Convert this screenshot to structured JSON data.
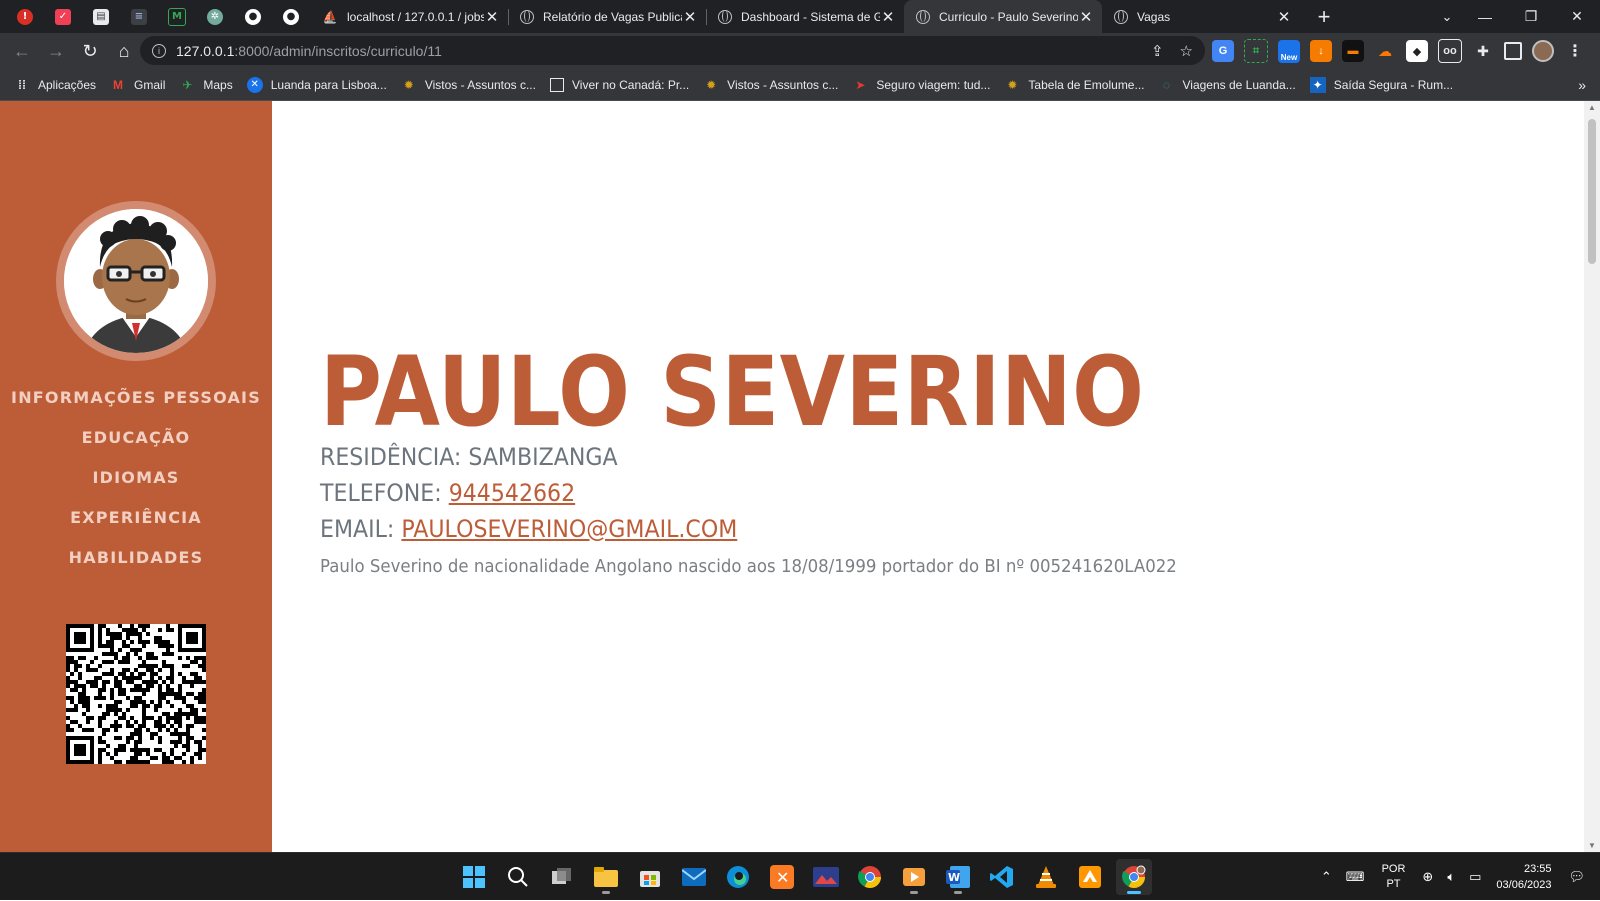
{
  "browser": {
    "tabs": [
      {
        "title": "localhost / 127.0.0.1 / jobs",
        "icon": "phpmyadmin-icon",
        "active": false
      },
      {
        "title": "Relatório de Vagas Publicadas",
        "icon": "globe-icon",
        "active": false
      },
      {
        "title": "Dashboard - Sistema de Gestão",
        "icon": "globe-icon",
        "active": false
      },
      {
        "title": "Curriculo - Paulo Severino",
        "icon": "globe-icon",
        "active": true
      },
      {
        "title": "Vagas",
        "icon": "globe-icon",
        "active": false
      }
    ],
    "url_host": "127.0.0.1",
    "url_rest": ":8000/admin/inscritos/curriculo/11",
    "new_badge": "New",
    "bookmarks": [
      {
        "label": "Aplicações",
        "icon": "apps-grid-icon"
      },
      {
        "label": "Gmail",
        "icon": "gmail-icon"
      },
      {
        "label": "Maps",
        "icon": "maps-icon"
      },
      {
        "label": "Luanda para Lisboa...",
        "icon": "flight-icon"
      },
      {
        "label": "Vistos - Assuntos c...",
        "icon": "emblem-icon"
      },
      {
        "label": "Viver no Canadá: Pr...",
        "icon": "page-icon"
      },
      {
        "label": "Vistos - Assuntos c...",
        "icon": "emblem-icon"
      },
      {
        "label": "Seguro viagem: tud...",
        "icon": "plane-icon"
      },
      {
        "label": "Tabela de Emolume...",
        "icon": "emblem-icon"
      },
      {
        "label": "Viagens de Luanda...",
        "icon": "loading-icon"
      },
      {
        "label": "Saída Segura - Rum...",
        "icon": "shield-icon"
      }
    ]
  },
  "resume": {
    "nav": [
      "INFORMAÇÕES PESSOAIS",
      "EDUCAÇÃO",
      "IDIOMAS",
      "EXPERIÊNCIA",
      "HABILIDADES"
    ],
    "name": "PAULO SEVERINO",
    "residence_label": "RESIDÊNCIA:",
    "residence": "SAMBIZANGA",
    "phone_label": "TELEFONE:",
    "phone": "944542662",
    "email_label": "EMAIL:",
    "email": "PAULOSEVERINO@GMAIL.COM",
    "bio": "Paulo Severino de nacionalidade Angolano nascido aos 18/08/1999 portador do BI nº 005241620LA022"
  },
  "colors": {
    "primary": "#bd5d38",
    "sidebar_text": "#f2cfc0",
    "muted": "#6c757d"
  },
  "taskbar": {
    "apps": [
      "windows-start-icon",
      "search-icon",
      "task-view-icon",
      "file-explorer-icon",
      "store-icon",
      "mail-icon",
      "edge-icon",
      "xampp-icon",
      "photos-icon",
      "chrome-icon",
      "player-icon",
      "word-icon",
      "vscode-icon",
      "vlc-icon",
      "sublime-icon",
      "chrome-profile-icon"
    ],
    "lang_top": "POR",
    "lang_bottom": "PT",
    "time": "23:55",
    "date": "03/06/2023"
  }
}
